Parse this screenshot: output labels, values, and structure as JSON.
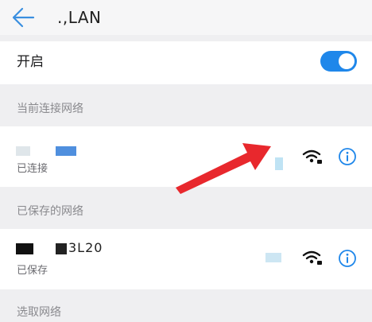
{
  "header": {
    "title": ".,LAN",
    "back_icon": "arrow-left-icon"
  },
  "toggle": {
    "label": "开启",
    "state": "on",
    "accent_color": "#1f87ea"
  },
  "sections": {
    "current": "当前连接网络",
    "saved": "已保存的网络",
    "choose": "选取网络"
  },
  "connected_network": {
    "status": "已连接",
    "signal_icon": "wifi-locked-icon",
    "info_icon": "info-icon"
  },
  "saved_network": {
    "ssid_visible": "3L20",
    "status": "已保存",
    "signal_icon": "wifi-locked-icon",
    "info_icon": "info-icon"
  },
  "annotation": {
    "arrow_color": "#e8282d"
  }
}
